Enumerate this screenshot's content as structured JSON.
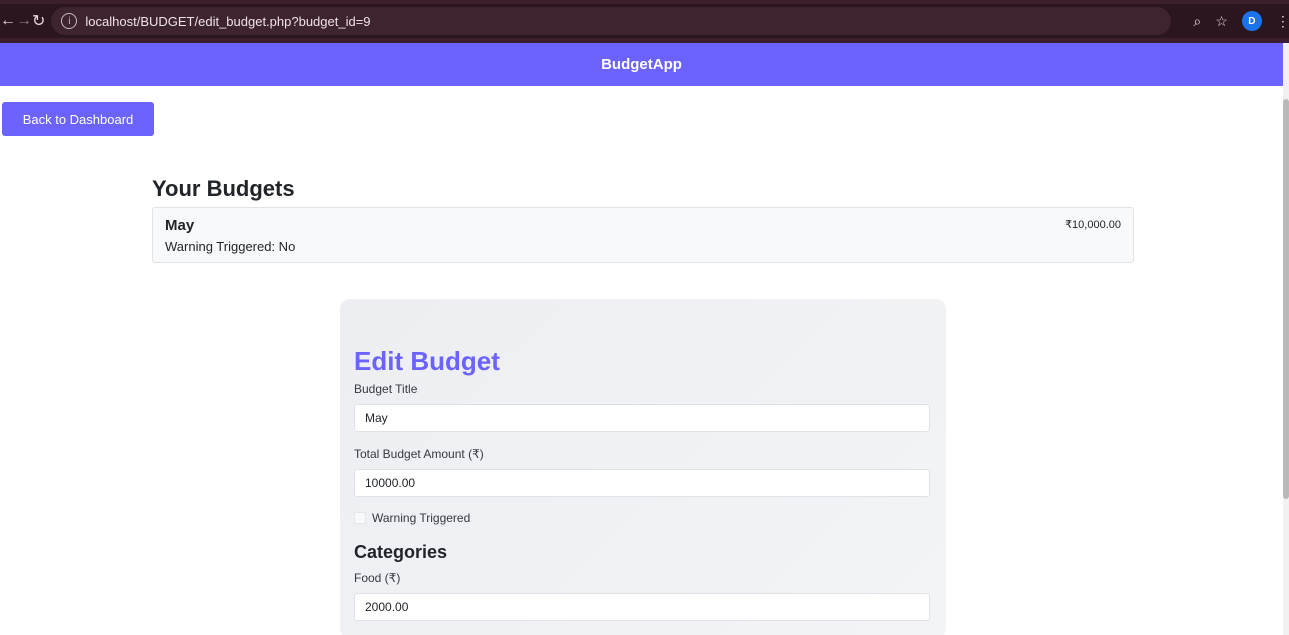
{
  "browser": {
    "url": "localhost/BUDGET/edit_budget.php?budget_id=9",
    "avatar_letter": "D"
  },
  "app": {
    "brand": "BudgetApp",
    "back_button": "Back to Dashboard"
  },
  "budgets": {
    "heading": "Your Budgets",
    "items": [
      {
        "name": "May",
        "warning": "Warning Triggered: No",
        "amount": "₹10,000.00"
      }
    ]
  },
  "edit_form": {
    "title": "Edit Budget",
    "title_label": "Budget Title",
    "title_value": "May",
    "amount_label": "Total Budget Amount (₹)",
    "amount_value": "10000.00",
    "warning_label": "Warning Triggered",
    "warning_checked": false,
    "categories_heading": "Categories",
    "categories": [
      {
        "label": "Food (₹)",
        "value": "2000.00"
      }
    ]
  },
  "colors": {
    "accent": "#6c63ff",
    "chrome": "#2b1520"
  }
}
